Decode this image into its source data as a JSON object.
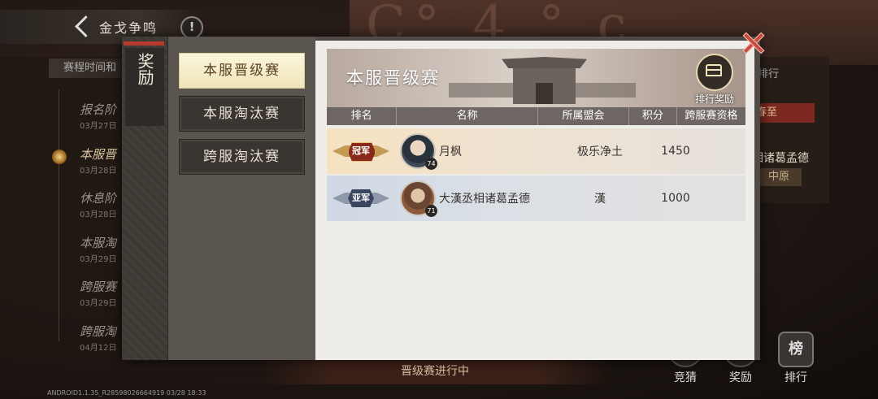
{
  "header": {
    "title": "金戈争鸣",
    "info_symbol": "!"
  },
  "background": {
    "glyphs": "C° 4 ° c"
  },
  "schedule": {
    "header": "赛程时间和",
    "stages": [
      {
        "name": "报名阶",
        "date": "03月27日"
      },
      {
        "name": "本服晋",
        "date": "03月28日"
      },
      {
        "name": "休息阶",
        "date": "03月28日"
      },
      {
        "name": "本服淘",
        "date": "03月29日"
      },
      {
        "name": "跨服赛",
        "date": "03月29日"
      },
      {
        "name": "跨服淘",
        "date": "04月12日"
      }
    ]
  },
  "right_panel": {
    "label": "排行",
    "badge": "春至",
    "player": "相诸葛孟德",
    "badge2": "中原"
  },
  "modal": {
    "side_tab": "奖励",
    "nav": [
      {
        "label": "本服晋级赛",
        "active": true
      },
      {
        "label": "本服淘汰赛",
        "active": false
      },
      {
        "label": "跨服淘汰赛",
        "active": false
      }
    ],
    "banner_title": "本服晋级赛",
    "reward_button_label": "排行奖励",
    "columns": [
      "排名",
      "名称",
      "所属盟会",
      "积分",
      "跨服赛资格"
    ],
    "rows": [
      {
        "rank_label": "冠军",
        "level": "74",
        "name": "月枫",
        "alliance": "极乐净土",
        "score": "1450",
        "qualification": ""
      },
      {
        "rank_label": "亚军",
        "level": "71",
        "name": "大漢丞相诸葛孟德",
        "alliance": "漢",
        "score": "1000",
        "qualification": ""
      }
    ]
  },
  "status": "晋级赛进行中",
  "bottom_buttons": [
    {
      "label": "竞猜",
      "icon": ""
    },
    {
      "label": "奖励",
      "icon": ""
    },
    {
      "label": "排行",
      "icon": "榜"
    }
  ],
  "version": "ANDROID1.1.35_R28598026664919 03/28 18:33"
}
